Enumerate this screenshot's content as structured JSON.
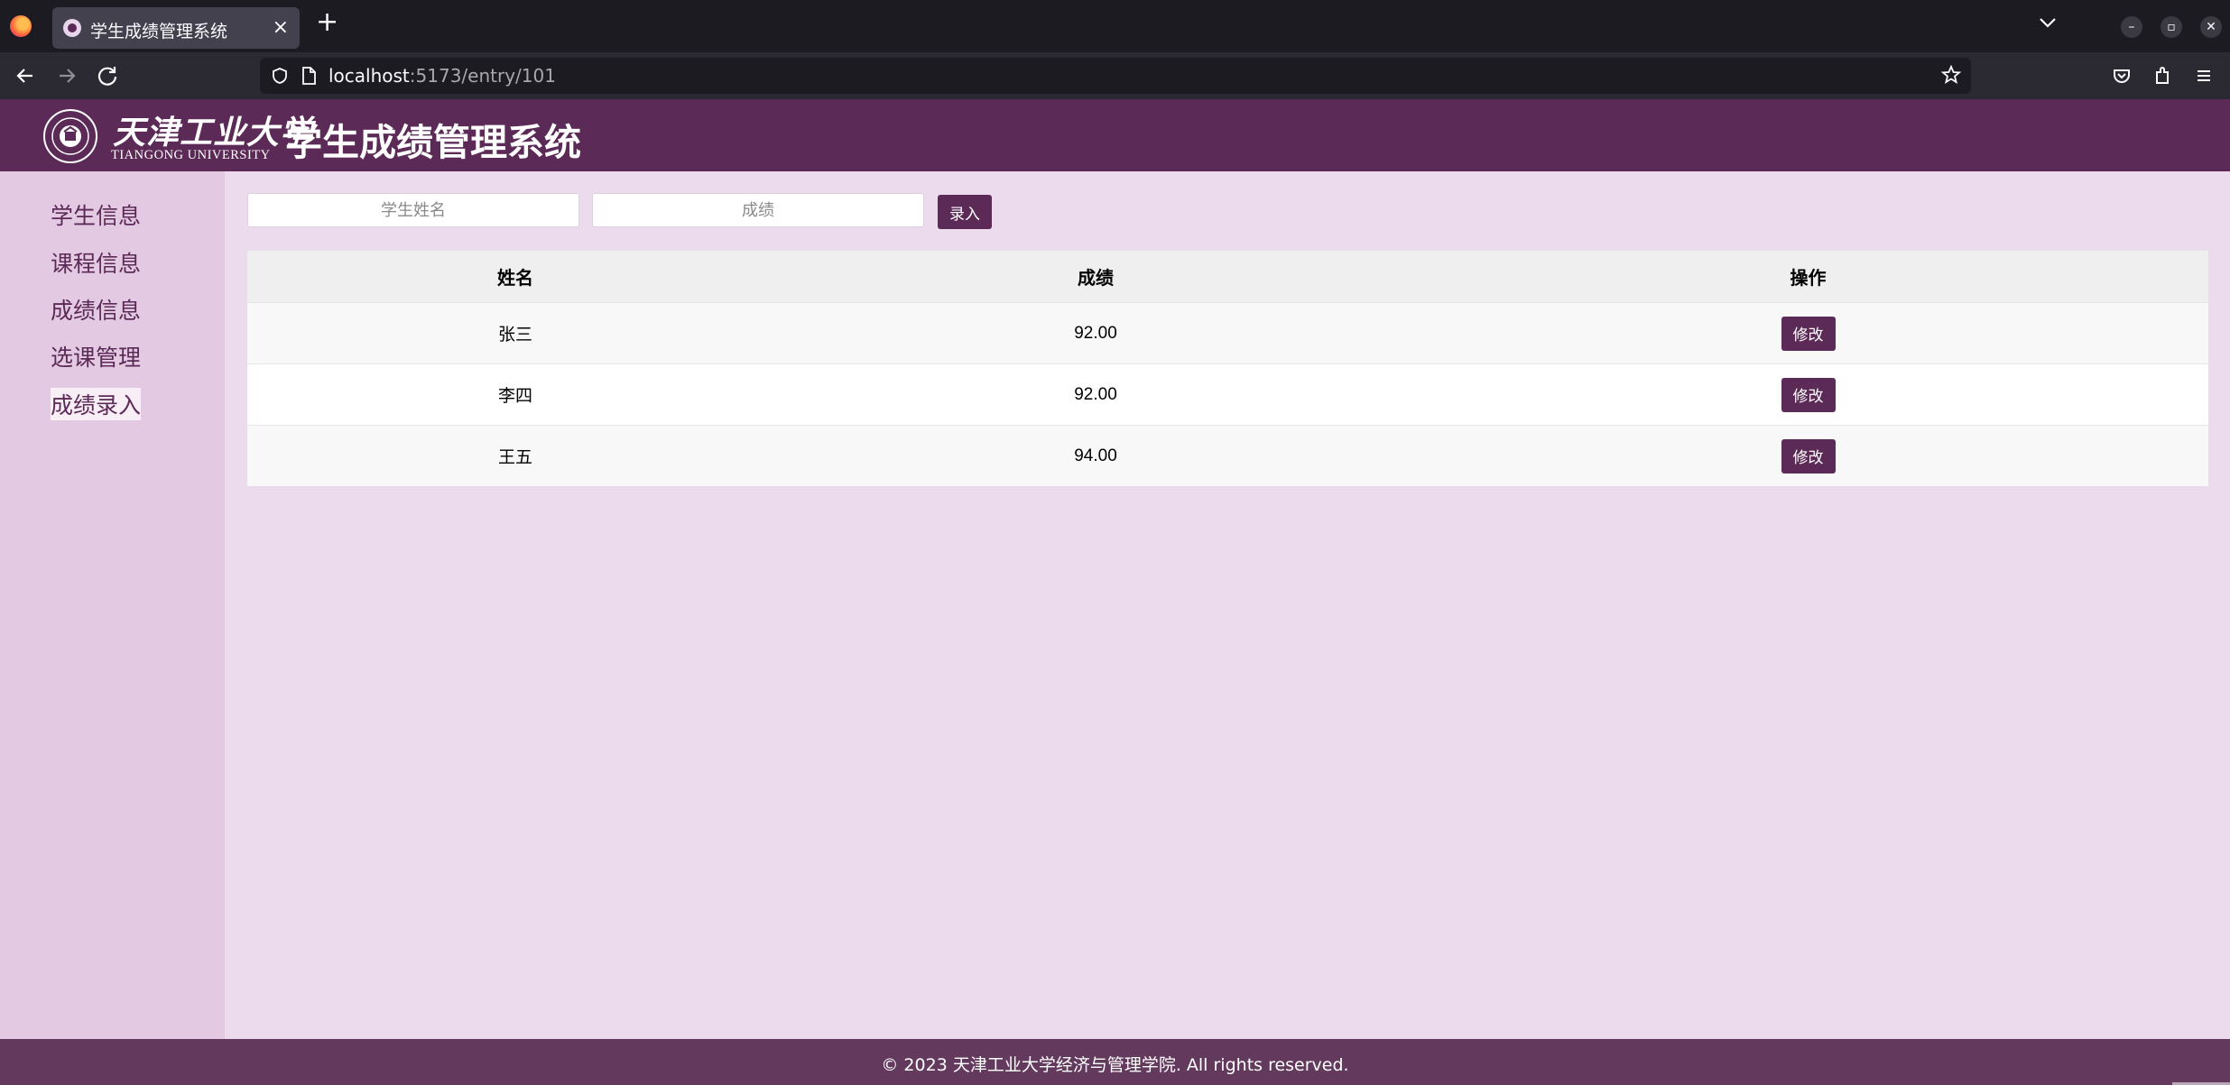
{
  "browser": {
    "tab_title": "学生成绩管理系统",
    "url_host": "localhost",
    "url_path": ":5173/entry/101"
  },
  "header": {
    "university_name_cn": "天津工业大学",
    "university_name_en": "TIANGONG UNIVERSITY",
    "app_title": "学生成绩管理系统"
  },
  "sidebar": {
    "items": [
      {
        "label": "学生信息"
      },
      {
        "label": "课程信息"
      },
      {
        "label": "成绩信息"
      },
      {
        "label": "选课管理"
      },
      {
        "label": "成绩录入",
        "active": true
      }
    ]
  },
  "form": {
    "name_placeholder": "学生姓名",
    "score_placeholder": "成绩",
    "submit_label": "录入"
  },
  "table": {
    "columns": [
      "姓名",
      "成绩",
      "操作"
    ],
    "rows": [
      {
        "name": "张三",
        "score": "92.00",
        "action": "修改"
      },
      {
        "name": "李四",
        "score": "92.00",
        "action": "修改"
      },
      {
        "name": "王五",
        "score": "94.00",
        "action": "修改"
      }
    ]
  },
  "footer": {
    "text": "© 2023 天津工业大学经济与管理学院. All rights reserved."
  },
  "colors": {
    "brand": "#5c2a57",
    "sidebar_bg": "#e3c9e2",
    "page_bg": "#ecdbec",
    "footer_bg": "#633a5e"
  }
}
